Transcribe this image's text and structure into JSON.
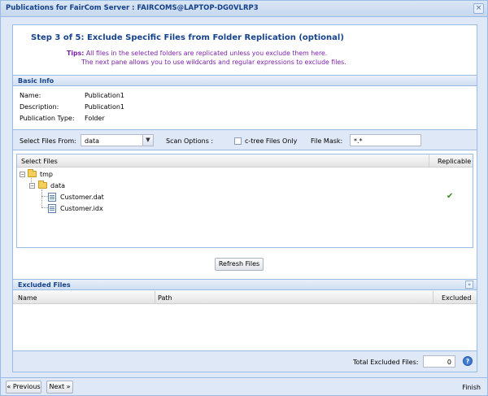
{
  "window": {
    "title": "Publications for FairCom Server : FAIRCOMS@LAPTOP-DG0VLRP3",
    "close_glyph": "×"
  },
  "step": {
    "title": "Step 3 of 5: Exclude Specific Files from Folder Replication (optional)",
    "tips_label": "Tips:",
    "tips_line1": "All files in the selected folders are replicated unless you exclude them here.",
    "tips_line2": "The next pane allows you to use wildcards and regular expressions to exclude files."
  },
  "basic_info": {
    "header": "Basic Info",
    "rows": [
      {
        "key": "Name:",
        "value": "Publication1"
      },
      {
        "key": "Description:",
        "value": "Publication1"
      },
      {
        "key": "Publication Type:",
        "value": "Folder"
      }
    ]
  },
  "filter": {
    "select_from_label": "Select Files From:",
    "select_from_value": "data",
    "scan_options_label": "Scan Options :",
    "ctree_only_label": "c-tree Files Only",
    "ctree_only_checked": false,
    "file_mask_label": "File Mask:",
    "file_mask_value": "*.*"
  },
  "files_grid": {
    "col_select": "Select Files",
    "col_replicable": "Replicable",
    "tree": [
      {
        "name": "tmp",
        "type": "folder",
        "expanded": true
      },
      {
        "name": "data",
        "type": "folder",
        "expanded": true
      },
      {
        "name": "Customer.dat",
        "type": "file",
        "replicable": true
      },
      {
        "name": "Customer.idx",
        "type": "file",
        "replicable": false
      }
    ],
    "check_glyph": "✔",
    "expander_glyph": "−"
  },
  "refresh_button": "Refresh Files",
  "excluded": {
    "header": "Excluded Files",
    "collapse_glyph": "»",
    "col_name": "Name",
    "col_path": "Path",
    "col_excluded": "Excluded",
    "rows": []
  },
  "total": {
    "label": "Total Excluded Files:",
    "value": "0",
    "help_glyph": "?"
  },
  "nav": {
    "previous": "« Previous",
    "next": "Next »",
    "finish": "Finish"
  },
  "colors": {
    "accent": "#15428b",
    "tips": "#7a1fa8",
    "panel_bg": "#dfe8f6",
    "border": "#99bbe8",
    "check": "#3a8a1a"
  },
  "icons": [
    "close-icon",
    "folder-icon",
    "file-icon",
    "check-icon",
    "dropdown-arrow-icon",
    "collapse-icon",
    "help-icon"
  ]
}
